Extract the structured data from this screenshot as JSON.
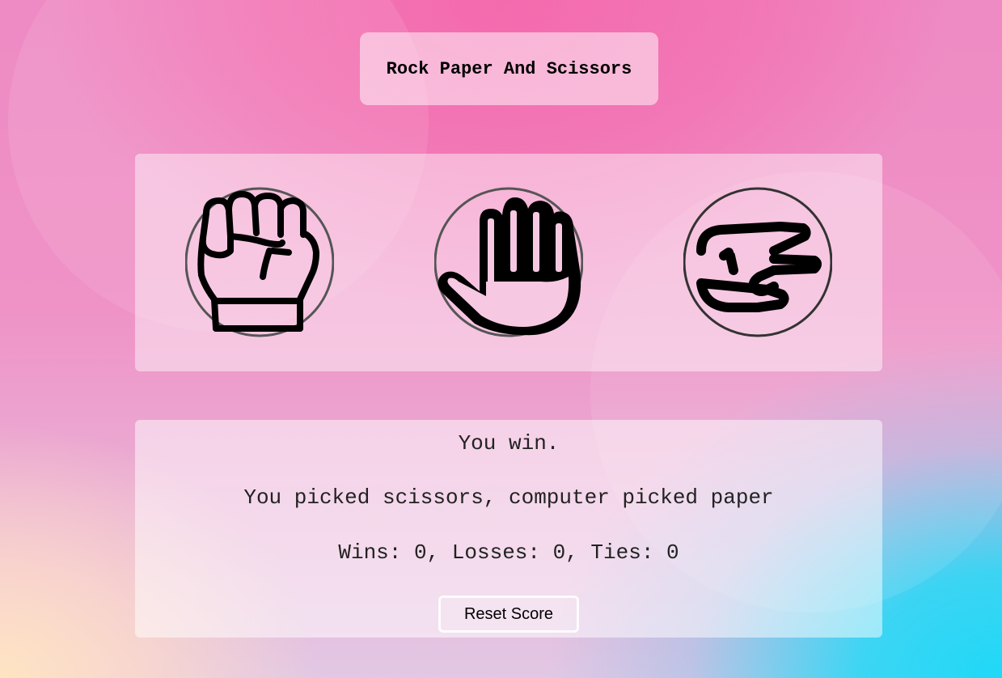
{
  "title": "Rock Paper And Scissors",
  "choices": [
    {
      "name": "rock",
      "icon": "fist-icon"
    },
    {
      "name": "paper",
      "icon": "open-hand-icon"
    },
    {
      "name": "scissors",
      "icon": "scissors-hand-icon"
    }
  ],
  "results": {
    "result": "You win.",
    "moves": "You picked scissors, computer picked paper",
    "score": "Wins: 0, Losses: 0, Ties: 0"
  },
  "reset_label": "Reset Score",
  "colors": {
    "accent_pink": "#f46aad",
    "accent_cyan": "#1fd8f7",
    "text": "#222222"
  }
}
